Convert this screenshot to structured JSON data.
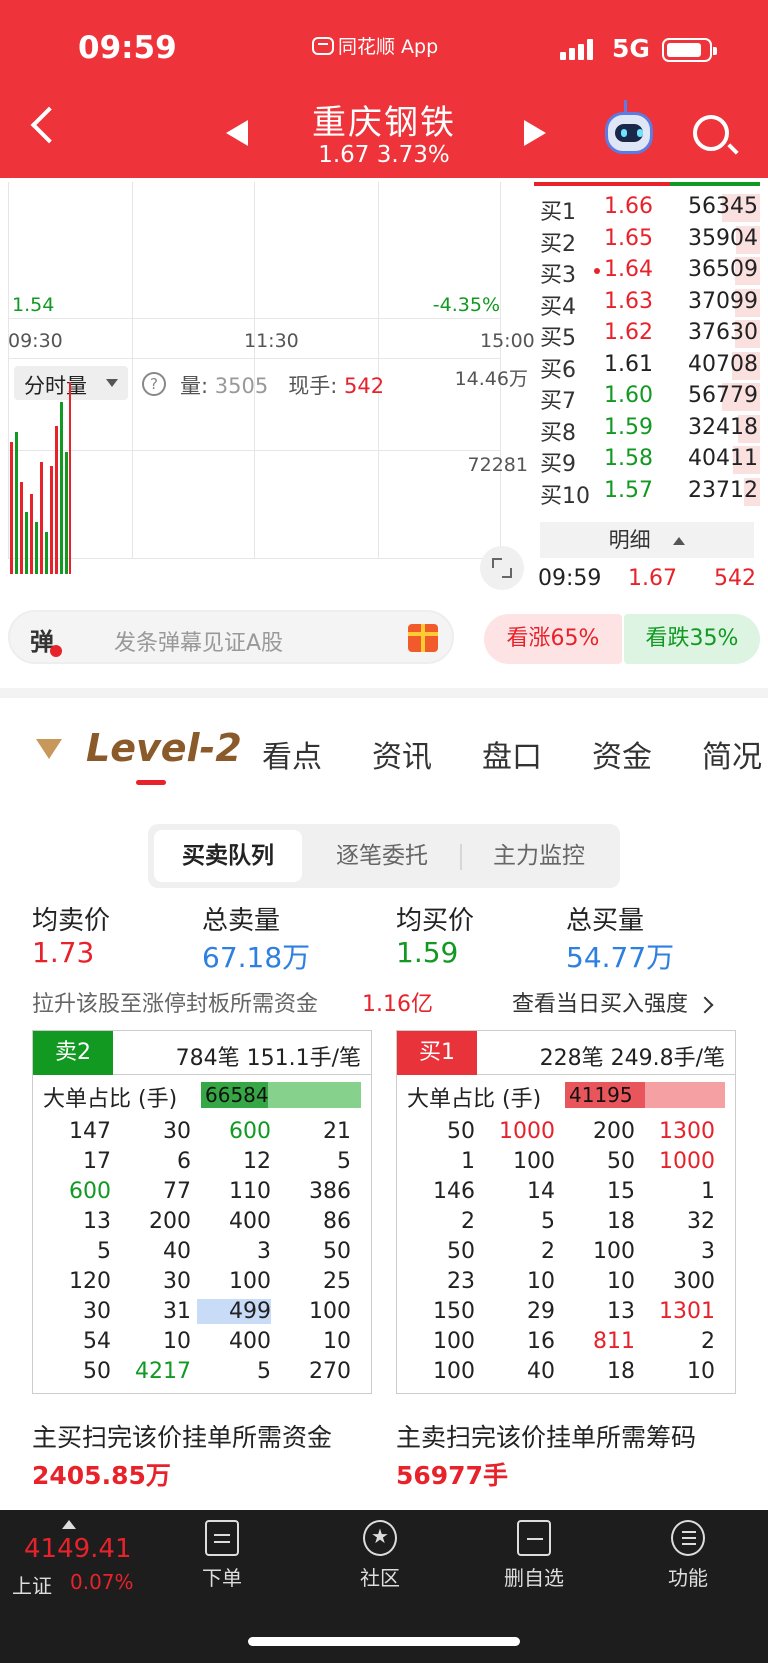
{
  "status": {
    "time": "09:59",
    "app": "同花顺 App",
    "network": "5G"
  },
  "header": {
    "stock_name": "重庆钢铁",
    "price": "1.67",
    "change_pct": "3.73%"
  },
  "chart": {
    "low_price": "1.54",
    "low_pct": "-4.35%",
    "times": [
      "09:30",
      "11:30",
      "15:00"
    ],
    "volume_tab": "分时量",
    "volume_label": "量:",
    "volume_value": "3505",
    "current_label": "现手:",
    "current_value": "542",
    "vol_max": "14.46万",
    "vol_mid": "72281"
  },
  "orderbook": {
    "rows": [
      {
        "label": "买1",
        "price": "1.66",
        "vol": "56345",
        "color": "red",
        "dot": false,
        "fill": 0.38
      },
      {
        "label": "买2",
        "price": "1.65",
        "vol": "35904",
        "color": "red",
        "dot": false,
        "fill": 0.24
      },
      {
        "label": "买3",
        "price": "1.64",
        "vol": "36509",
        "color": "red",
        "dot": true,
        "fill": 0.25
      },
      {
        "label": "买4",
        "price": "1.63",
        "vol": "37099",
        "color": "red",
        "dot": false,
        "fill": 0.25
      },
      {
        "label": "买5",
        "price": "1.62",
        "vol": "37630",
        "color": "red",
        "dot": false,
        "fill": 0.25
      },
      {
        "label": "买6",
        "price": "1.61",
        "vol": "40708",
        "color": "dark",
        "dot": false,
        "fill": 0.28
      },
      {
        "label": "买7",
        "price": "1.60",
        "vol": "56779",
        "color": "green",
        "dot": false,
        "fill": 0.38
      },
      {
        "label": "买8",
        "price": "1.59",
        "vol": "32418",
        "color": "green",
        "dot": false,
        "fill": 0.22
      },
      {
        "label": "买9",
        "price": "1.58",
        "vol": "40411",
        "color": "green",
        "dot": false,
        "fill": 0.27
      },
      {
        "label": "买10",
        "price": "1.57",
        "vol": "23712",
        "color": "green",
        "dot": false,
        "fill": 0.16
      }
    ],
    "detail_label": "明细",
    "tick_time": "09:59",
    "tick_price": "1.67",
    "tick_vol": "542"
  },
  "danmu": {
    "icon": "弹",
    "placeholder": "发条弹幕见证A股"
  },
  "sentiment": {
    "bull": "看涨65%",
    "bear": "看跌35%"
  },
  "tabs": [
    "Level-2",
    "看点",
    "资讯",
    "盘口",
    "资金",
    "简况"
  ],
  "segments": [
    "买卖队列",
    "逐笔委托",
    "主力监控"
  ],
  "stats": {
    "avg_sell_label": "均卖价",
    "avg_sell": "1.73",
    "total_sell_label": "总卖量",
    "total_sell": "67.18万",
    "avg_buy_label": "均买价",
    "avg_buy": "1.59",
    "total_buy_label": "总买量",
    "total_buy": "54.77万",
    "pushup_label": "拉升该股至涨停封板所需资金",
    "pushup_value": "1.16亿",
    "view_strength": "查看当日买入强度"
  },
  "sell_panel": {
    "tag": "卖2",
    "count": "784笔  151.1手/笔",
    "big_label": "大单占比 (手)",
    "big_value": "66584",
    "big_fill": 0.42,
    "rows": [
      [
        "147",
        "30",
        "600",
        "21"
      ],
      [
        "17",
        "6",
        "12",
        "5"
      ],
      [
        "600",
        "77",
        "110",
        "386"
      ],
      [
        "13",
        "200",
        "400",
        "86"
      ],
      [
        "5",
        "40",
        "3",
        "50"
      ],
      [
        "120",
        "30",
        "100",
        "25"
      ],
      [
        "30",
        "31",
        "499",
        "100"
      ],
      [
        "54",
        "10",
        "400",
        "10"
      ],
      [
        "50",
        "4217",
        "5",
        "270"
      ]
    ],
    "green_cells": [
      "0-2",
      "2-0",
      "8-1"
    ],
    "blue_cells": [
      "6-2"
    ]
  },
  "buy_panel": {
    "tag": "买1",
    "count": "228笔  249.8手/笔",
    "big_label": "大单占比 (手)",
    "big_value": "41195",
    "big_fill": 0.5,
    "rows": [
      [
        "50",
        "1000",
        "200",
        "1300"
      ],
      [
        "1",
        "100",
        "50",
        "1000"
      ],
      [
        "146",
        "14",
        "15",
        "1"
      ],
      [
        "2",
        "5",
        "18",
        "32"
      ],
      [
        "50",
        "2",
        "100",
        "3"
      ],
      [
        "23",
        "10",
        "10",
        "300"
      ],
      [
        "150",
        "29",
        "13",
        "1301"
      ],
      [
        "100",
        "16",
        "811",
        "2"
      ],
      [
        "100",
        "40",
        "18",
        "10"
      ]
    ],
    "red_cells": [
      "0-1",
      "0-3",
      "1-3",
      "6-3",
      "7-2"
    ]
  },
  "scan": {
    "buy_label": "主买扫完该价挂单所需资金",
    "buy_value": "2405.85万",
    "sell_label": "主卖扫完该价挂单所需筹码",
    "sell_value": "56977手"
  },
  "bottom": {
    "index_value": "4149.41",
    "index_name": "上证",
    "index_pct": "0.07%",
    "nav": [
      "下单",
      "社区",
      "删自选",
      "功能"
    ]
  }
}
